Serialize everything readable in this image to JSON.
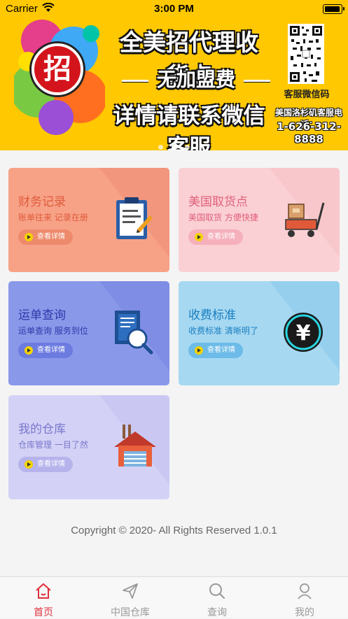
{
  "status_bar": {
    "carrier": "Carrier",
    "time": "3:00 PM"
  },
  "banner": {
    "badge": "招",
    "line1": "全美招代理收货点",
    "line2": "无加盟费",
    "line3": "详情请联系微信客服",
    "qr_caption": "客服微信码",
    "phone_label": "美国洛杉矶客服电话：",
    "phone": "1-626-312-8888",
    "slides": 3,
    "active_slide": 2
  },
  "cards": [
    {
      "title": "财务记录",
      "subtitle": "账单往来  记录在册",
      "button": "查看详情",
      "icon": "clipboard-icon"
    },
    {
      "title": "美国取货点",
      "subtitle": "美国取货  方便快捷",
      "button": "查看详情",
      "icon": "cart-icon"
    },
    {
      "title": "运单查询",
      "subtitle": "运单查询  服务到位",
      "button": "查看详情",
      "icon": "document-search-icon"
    },
    {
      "title": "收费标准",
      "subtitle": "收费标准  清晰明了",
      "button": "查看详情",
      "icon": "yen-coin-icon"
    },
    {
      "title": "我的仓库",
      "subtitle": "仓库管理  一目了然",
      "button": "查看详情",
      "icon": "warehouse-icon"
    }
  ],
  "copyright": "Copyright © 2020- All Rights Reserved 1.0.1",
  "tabbar": {
    "items": [
      {
        "label": "首页",
        "icon": "home-icon",
        "active": true
      },
      {
        "label": "中国仓库",
        "icon": "send-icon",
        "active": false
      },
      {
        "label": "查询",
        "icon": "search-icon",
        "active": false
      },
      {
        "label": "我的",
        "icon": "user-icon",
        "active": false
      }
    ]
  },
  "colors": {
    "banner_bg": "#ffc800",
    "active_tab": "#e0303c",
    "inactive_tab": "#999999"
  }
}
